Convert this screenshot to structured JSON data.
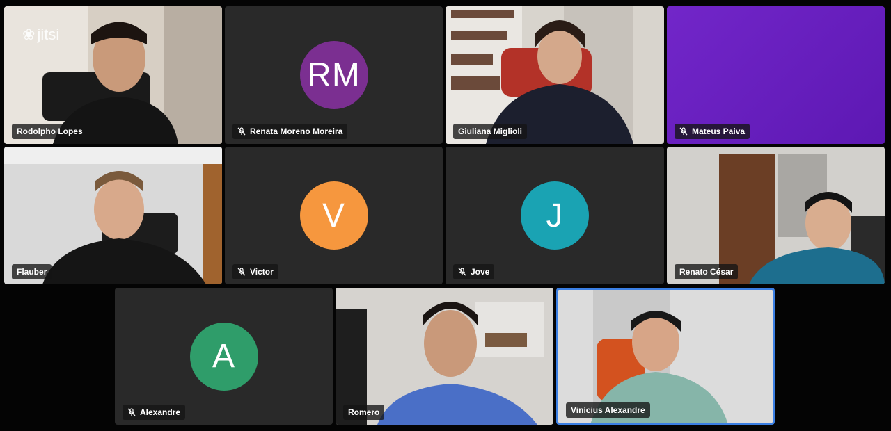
{
  "app": {
    "logo_text": "jitsi"
  },
  "participants": [
    {
      "name": "Rodolpho Lopes",
      "muted": false,
      "video": true
    },
    {
      "name": "Renata Moreno Moreira",
      "muted": true,
      "video": false,
      "initials": "RM",
      "color": "#7b2f91"
    },
    {
      "name": "Giuliana Miglioli",
      "muted": false,
      "video": true
    },
    {
      "name": "Mateus Paiva",
      "muted": true,
      "video": true,
      "bg_color": "#6a1fc0"
    },
    {
      "name": "Flauber",
      "muted": false,
      "video": true
    },
    {
      "name": "Victor",
      "muted": true,
      "video": false,
      "initials": "V",
      "color": "#f6973e"
    },
    {
      "name": "Jove",
      "muted": true,
      "video": false,
      "initials": "J",
      "color": "#1aa3b3"
    },
    {
      "name": "Renato César",
      "muted": false,
      "video": true
    },
    {
      "name": "Alexandre",
      "muted": true,
      "video": false,
      "initials": "A",
      "color": "#2f9d6a"
    },
    {
      "name": "Romero",
      "muted": false,
      "video": true
    },
    {
      "name": "Vinícius Alexandre",
      "muted": false,
      "video": true,
      "active_speaker": true
    }
  ]
}
